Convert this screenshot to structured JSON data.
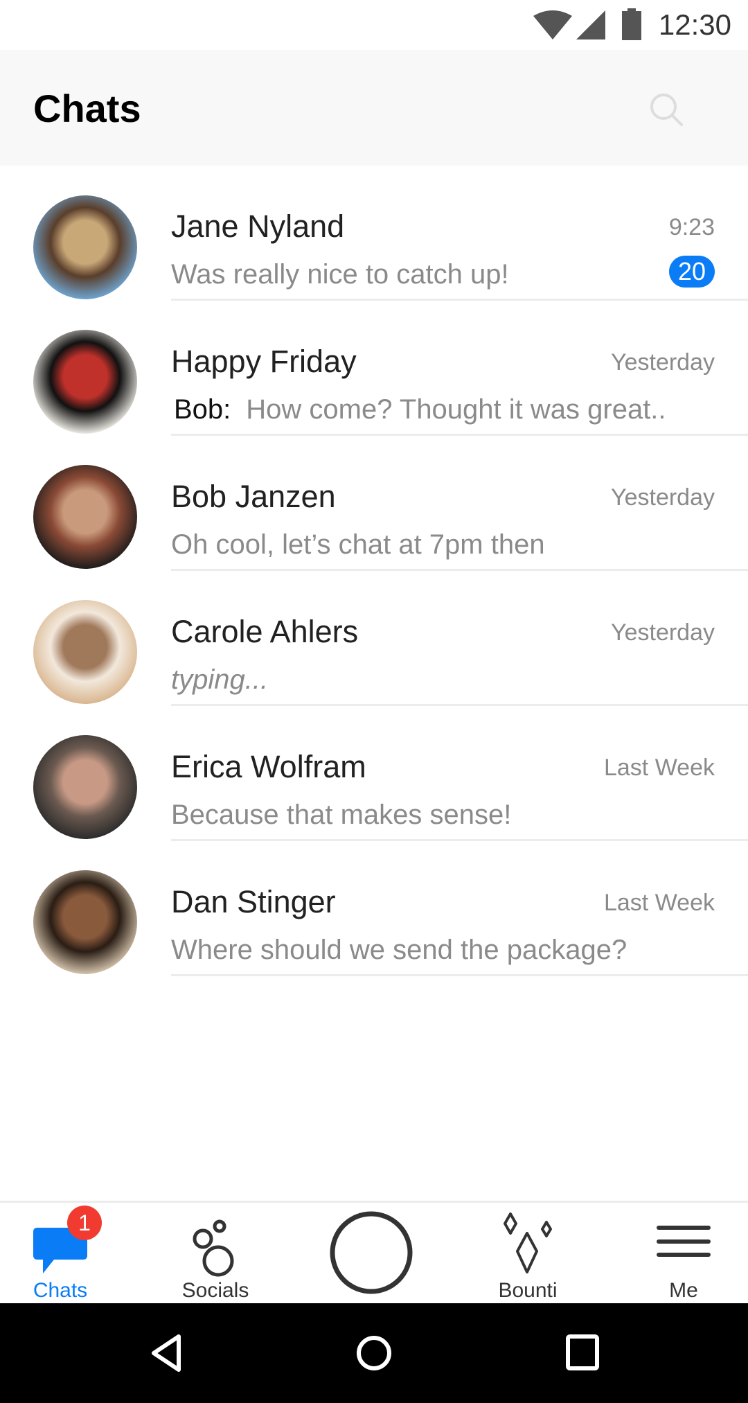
{
  "status_bar": {
    "time": "12:30",
    "icons": [
      "wifi-icon",
      "signal-icon",
      "battery-icon"
    ]
  },
  "header": {
    "title": "Chats",
    "search_icon": "search-icon"
  },
  "chats": [
    {
      "name": "Jane Nyland",
      "preview": "Was really nice to catch up!",
      "time": "9:23",
      "unread": "20",
      "avatar_colors": [
        "#6fa8d6",
        "#c9a878",
        "#5a3e2b"
      ]
    },
    {
      "name": "Happy Friday",
      "sender": "Bob:",
      "preview": "How come? Thought it was great..",
      "time": "Yesterday",
      "avatar_colors": [
        "#f4f1ea",
        "#c0312b",
        "#111111"
      ]
    },
    {
      "name": "Bob Janzen",
      "preview": "Oh cool, let’s chat at 7pm then",
      "time": "Yesterday",
      "avatar_colors": [
        "#1a1a1a",
        "#c99a7c",
        "#8a4a35"
      ]
    },
    {
      "name": "Carole Ahlers",
      "preview": "typing...",
      "time": "Yesterday",
      "italic": true,
      "avatar_colors": [
        "#d8b48c",
        "#a0785a",
        "#f2e8dc"
      ]
    },
    {
      "name": "Erica Wolfram",
      "preview": "Because that makes sense!",
      "time": "Last Week",
      "avatar_colors": [
        "#2a2a2a",
        "#c89a86",
        "#6b5a50"
      ]
    },
    {
      "name": "Dan Stinger",
      "preview": "Where should we send the package?",
      "time": "Last Week",
      "avatar_colors": [
        "#d9c8b0",
        "#8a5a3c",
        "#2a1d14"
      ]
    }
  ],
  "tabs": [
    {
      "label": "Chats",
      "icon": "chat-bubble-icon",
      "badge": "1",
      "active": true
    },
    {
      "label": "Socials",
      "icon": "socials-circles-icon"
    },
    {
      "label": "",
      "icon": "camera-circle-icon"
    },
    {
      "label": "Bounti",
      "icon": "sparkles-icon"
    },
    {
      "label": "Me",
      "icon": "menu-icon"
    }
  ],
  "colors": {
    "accent": "#0a7cf5",
    "badge_red": "#f23b30",
    "header_bg": "#f8f8f8"
  },
  "nav_bar": [
    "back-icon",
    "home-icon",
    "recents-icon"
  ]
}
